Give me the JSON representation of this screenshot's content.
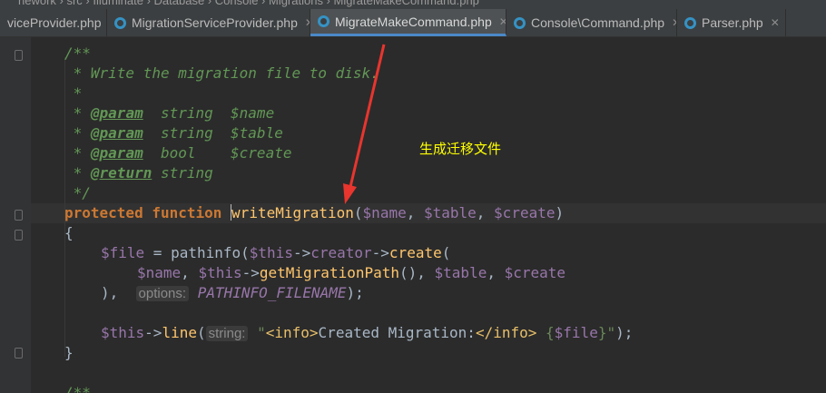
{
  "breadcrumb": "nework  ›  src  ›  Illuminate  ›  Database  ›  Console  ›  Migrations  ›  MigrateMakeCommand.php",
  "tabs": [
    {
      "label": "viceProvider.php",
      "active": false
    },
    {
      "label": "MigrationServiceProvider.php",
      "active": false
    },
    {
      "label": "MigrateMakeCommand.php",
      "active": true
    },
    {
      "label": "Console\\Command.php",
      "active": false
    },
    {
      "label": "Parser.php",
      "active": false
    }
  ],
  "code": {
    "l1": "/**",
    "l2": " * Write the migration file to disk.",
    "l3": " *",
    "star": " * ",
    "tag_param": "@param",
    "tag_return": "@return",
    "l4_rest": "  string  ",
    "l4_var": "$name",
    "l5_rest": "  string  ",
    "l5_var": "$table",
    "l6_rest": "  bool    ",
    "l6_var": "$create",
    "l7_rest": " string",
    "l8": " */",
    "kw_protected": "protected",
    "kw_function": "function",
    "fn_name": "writeMigration",
    "p_open": "(",
    "p_close": ")",
    "comma": ", ",
    "v_name": "$name",
    "v_table": "$table",
    "v_create": "$create",
    "brace_open": "{",
    "brace_close": "}",
    "v_file": "$file",
    "assign": " = ",
    "fn_pathinfo": "pathinfo",
    "v_this": "$this",
    "arrow_op": "->",
    "prop_creator": "creator",
    "fn_create": "create",
    "fn_getMigrationPath": "getMigrationPath",
    "empty_call": "()",
    "close_paren_comma": "),",
    "hint_options": "options:",
    "const_pathinfo": "PATHINFO_FILENAME",
    "end_stmt": ");",
    "fn_line": "line",
    "hint_string": "string:",
    "str_q1": "\"",
    "tag_info_open": "<info>",
    "str_created": "Created Migration:",
    "tag_info_close": "</info>",
    "str_space": " ",
    "interp_open": "{",
    "interp_close": "}",
    "str_q2": "\"",
    "l_last": "/**"
  },
  "annotation": "生成迁移文件",
  "colors": {
    "arrow": "#e8352e",
    "annotation": "#ffff00"
  }
}
